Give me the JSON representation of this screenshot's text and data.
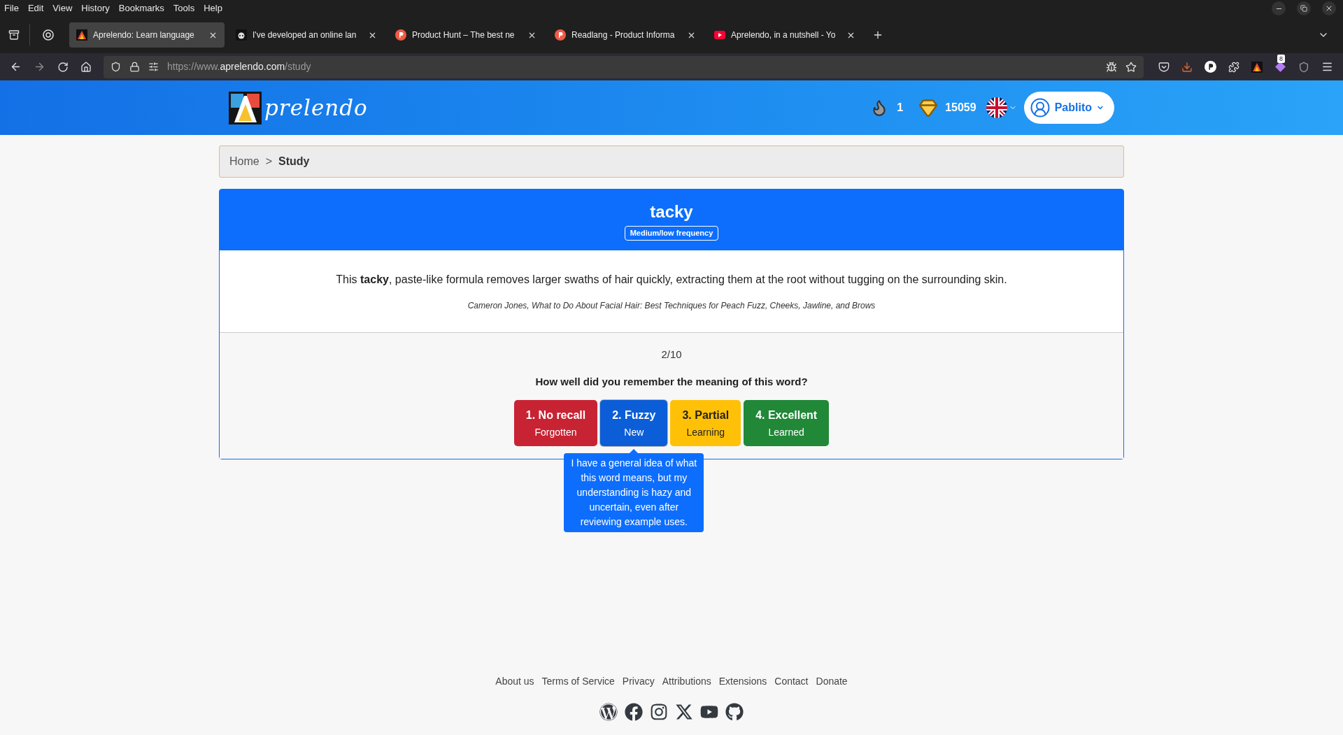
{
  "menu_bar": [
    "File",
    "Edit",
    "View",
    "History",
    "Bookmarks",
    "Tools",
    "Help"
  ],
  "browser_tabs": [
    {
      "title": "Aprelendo: Learn language",
      "kind": "aprelendo",
      "selected": true
    },
    {
      "title": "I've developed an online lan",
      "kind": "alien",
      "selected": false
    },
    {
      "title": "Product Hunt – The best ne",
      "kind": "producthunt",
      "selected": false
    },
    {
      "title": "Readlang - Product Informa",
      "kind": "producthunt",
      "selected": false
    },
    {
      "title": "Aprelendo, in a nutshell - Yo",
      "kind": "youtube",
      "selected": false
    }
  ],
  "address_bar": {
    "prefix": "https://www.",
    "domain": "aprelendo.com",
    "path": "/study"
  },
  "toolbar_badge": "8",
  "header": {
    "logo_text": "prelendo",
    "streak": "1",
    "gems": "15059",
    "user": "Pablito"
  },
  "breadcrumb": [
    {
      "label": "Home",
      "current": false
    },
    {
      "label": "Study",
      "current": true
    }
  ],
  "breadcrumb_separator": ">",
  "card": {
    "word": "tacky",
    "frequency": "Medium/low frequency",
    "sentence": "This **tacky**, paste-like formula removes larger swaths of hair quickly, extracting them at the root without tugging on the surrounding skin.",
    "source": "Cameron Jones, What to Do About Facial Hair: Best Techniques for Peach Fuzz, Cheeks, Jawline, and Brows",
    "progress": "2/10",
    "question": "How well did you remember the meaning of this word?",
    "answers": [
      {
        "label": "1. No recall",
        "status": "Forgotten",
        "color": "#c82333",
        "hovered": false
      },
      {
        "label": "2. Fuzzy",
        "status": "New",
        "color": "#0b5ed7",
        "hovered": true,
        "tooltip": "I have a general idea of what this word means, but my understanding is hazy and uncertain, even after reviewing example uses."
      },
      {
        "label": "3. Partial",
        "status": "Learning",
        "color": "#ffc107",
        "hovered": false
      },
      {
        "label": "4. Excellent",
        "status": "Learned",
        "color": "#218838",
        "hovered": false
      }
    ]
  },
  "footer_links": [
    "About us",
    "Terms of Service",
    "Privacy",
    "Attributions",
    "Extensions",
    "Contact",
    "Donate"
  ],
  "social_icons": [
    {
      "kind": "wordpress"
    },
    {
      "kind": "facebook"
    },
    {
      "kind": "instagram"
    },
    {
      "kind": "x"
    },
    {
      "kind": "youtube"
    },
    {
      "kind": "github"
    }
  ]
}
